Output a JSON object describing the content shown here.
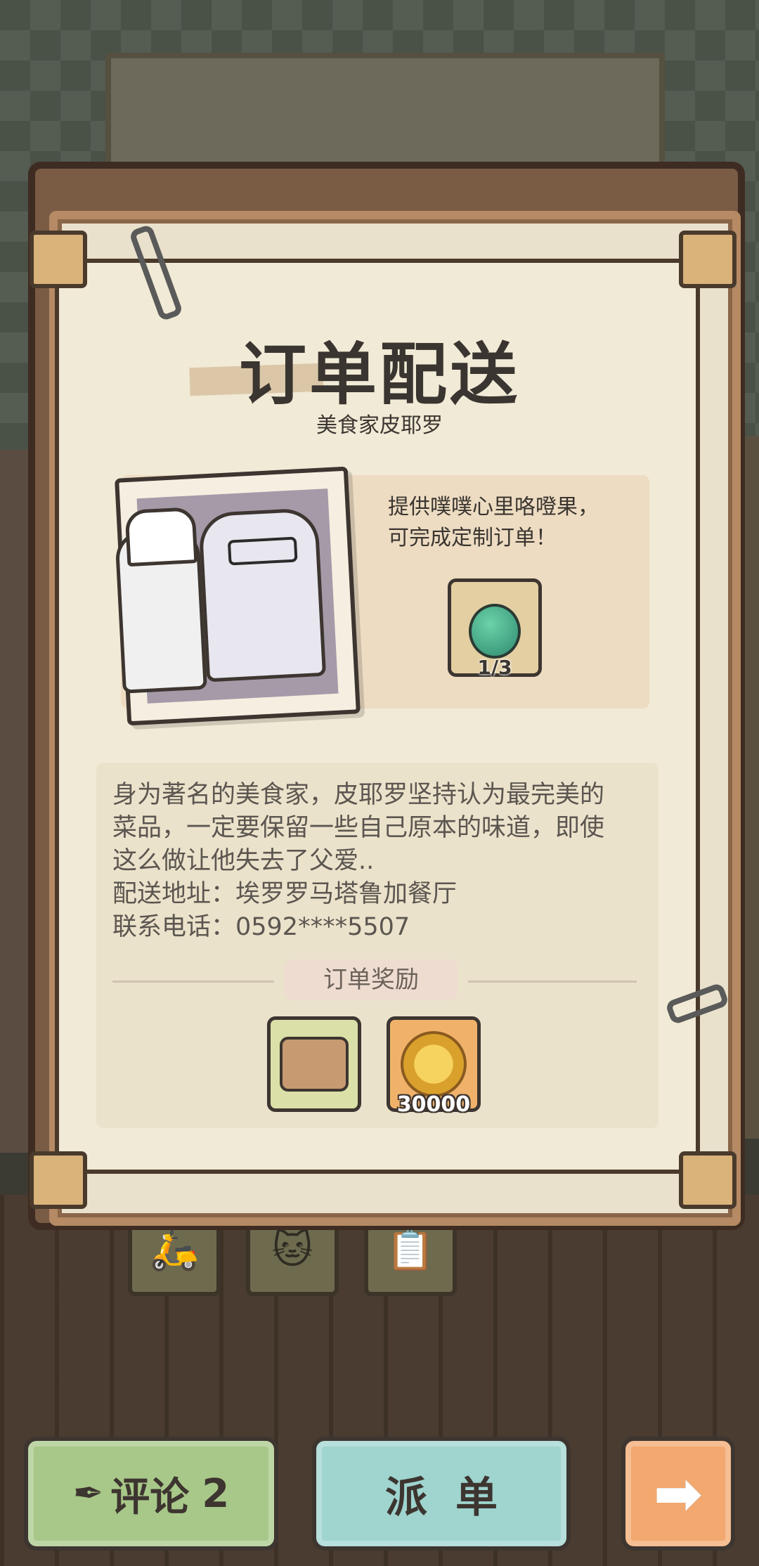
{
  "dialog": {
    "title": "订单配送",
    "customer": "美食家皮耶罗"
  },
  "requirement": {
    "text_line1": "提供噗噗心里咯噔果，",
    "text_line2": "可完成定制订单！",
    "item_icon": "green-fruit-icon",
    "progress": "1/3"
  },
  "description": {
    "line1": "身为著名的美食家，皮耶罗坚持认为最完美的",
    "line2": "菜品，一定要保留一些自己原本的味道，即使",
    "line3": "这么做让他失去了父爱..",
    "address": "配送地址：埃罗罗马塔鲁加餐厅",
    "phone": "联系电话：0592****5507"
  },
  "rewards": {
    "label": "订单奖励",
    "items": [
      {
        "icon": "food-can-icon",
        "count": ""
      },
      {
        "icon": "gold-coin-icon",
        "count": "30000"
      }
    ]
  },
  "buttons": {
    "review_label": "评论",
    "review_count": "2",
    "dispatch_label": "派单",
    "next_icon": "arrow-right-icon"
  },
  "colors": {
    "paper": "#f1ead6",
    "frame": "#b58a64",
    "review_button": "#a8c889",
    "dispatch_button": "#9fd4cf",
    "next_button": "#f2a86f"
  }
}
